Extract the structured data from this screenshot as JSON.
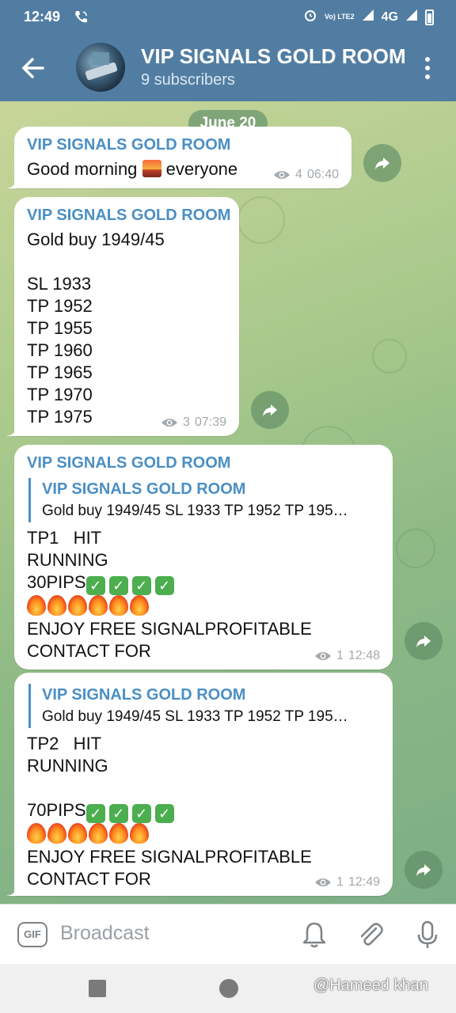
{
  "status_bar": {
    "time": "12:49",
    "network": "4G",
    "lte_label": "Vo) LTE2"
  },
  "header": {
    "title": "VIP SIGNALS GOLD ROOM",
    "subtitle": "9 subscribers"
  },
  "chat": {
    "date": "June 20",
    "messages": [
      {
        "sender": "VIP SIGNALS GOLD ROOM",
        "text_before": "Good morning ",
        "text_after": " everyone",
        "views": "4",
        "time": "06:40"
      },
      {
        "sender": "VIP SIGNALS GOLD ROOM",
        "text": "Gold buy 1949/45\n\nSL 1933\nTP 1952\nTP 1955\nTP 1960\nTP 1965\nTP 1970\nTP 1975",
        "views": "3",
        "time": "07:39"
      },
      {
        "sender": "VIP SIGNALS GOLD ROOM",
        "reply_name": "VIP SIGNALS GOLD ROOM",
        "reply_text": "Gold buy 1949/45  SL 1933 TP 1952 TP 195…",
        "line1": "TP1   HIT",
        "line2": "RUNNING",
        "pips": "30PIPS",
        "line4": "ENJOY FREE SIGNALPROFITABLE",
        "line5": "CONTACT FOR",
        "views": "1",
        "time": "12:48"
      },
      {
        "reply_name": "VIP SIGNALS GOLD ROOM",
        "reply_text": "Gold buy 1949/45  SL 1933 TP 1952 TP 195…",
        "line1": "TP2   HIT",
        "line2": "RUNNING",
        "pips": "70PIPS",
        "line4": "ENJOY FREE SIGNALPROFITABLE",
        "line5": "CONTACT FOR",
        "views": "1",
        "time": "12:49"
      }
    ]
  },
  "composer": {
    "placeholder": "Broadcast",
    "gif_label": "GIF"
  },
  "watermark": "@Hameed khan",
  "colors": {
    "header": "#517da2",
    "accent": "#4a8fc4"
  },
  "icons": [
    "phone-wifi-icon",
    "alarm-icon",
    "signal-icon",
    "battery-icon",
    "back-arrow-icon",
    "more-vert-icon",
    "eye-icon",
    "share-icon",
    "bell-icon",
    "paperclip-icon",
    "mic-icon",
    "gif-icon"
  ]
}
